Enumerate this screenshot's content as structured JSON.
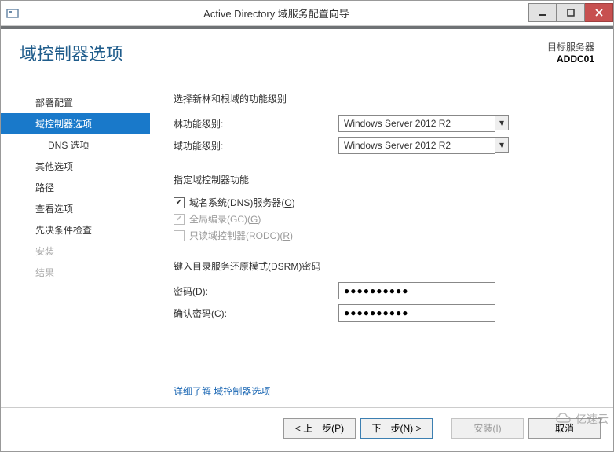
{
  "window": {
    "title": "Active Directory 域服务配置向导"
  },
  "header": {
    "page_title": "域控制器选项",
    "target_label": "目标服务器",
    "target_name": "ADDC01"
  },
  "sidebar": {
    "items": [
      {
        "label": "部署配置",
        "active": false,
        "disabled": false,
        "lvl": 1
      },
      {
        "label": "域控制器选项",
        "active": true,
        "disabled": false,
        "lvl": 1
      },
      {
        "label": "DNS 选项",
        "active": false,
        "disabled": false,
        "lvl": 2
      },
      {
        "label": "其他选项",
        "active": false,
        "disabled": false,
        "lvl": 1
      },
      {
        "label": "路径",
        "active": false,
        "disabled": false,
        "lvl": 1
      },
      {
        "label": "查看选项",
        "active": false,
        "disabled": false,
        "lvl": 1
      },
      {
        "label": "先决条件检查",
        "active": false,
        "disabled": false,
        "lvl": 1
      },
      {
        "label": "安装",
        "active": false,
        "disabled": true,
        "lvl": 1
      },
      {
        "label": "结果",
        "active": false,
        "disabled": true,
        "lvl": 1
      }
    ]
  },
  "content": {
    "section1_heading": "选择新林和根域的功能级别",
    "forest_label": "林功能级别:",
    "forest_value": "Windows Server 2012 R2",
    "domain_label": "域功能级别:",
    "domain_value": "Windows Server 2012 R2",
    "section2_heading": "指定域控制器功能",
    "dns_label_pre": "域名系统(DNS)服务器(",
    "dns_label_u": "O",
    "dns_label_post": ")",
    "gc_label_pre": "全局编录(GC)(",
    "gc_label_u": "G",
    "gc_label_post": ")",
    "rodc_label_pre": "只读域控制器(RODC)(",
    "rodc_label_u": "R",
    "rodc_label_post": ")",
    "section3_heading": "键入目录服务还原模式(DSRM)密码",
    "pwd_label_pre": "密码(",
    "pwd_label_u": "D",
    "pwd_label_post": "):",
    "pwd_value": "●●●●●●●●●●",
    "confirm_label_pre": "确认密码(",
    "confirm_label_u": "C",
    "confirm_label_post": "):",
    "confirm_value": "●●●●●●●●●●",
    "more_link_pre": "详细了解 ",
    "more_link": "域控制器选项"
  },
  "footer": {
    "prev": "< 上一步(P)",
    "next": "下一步(N) >",
    "install": "安装(I)",
    "cancel": "取消"
  },
  "watermark": "亿速云"
}
